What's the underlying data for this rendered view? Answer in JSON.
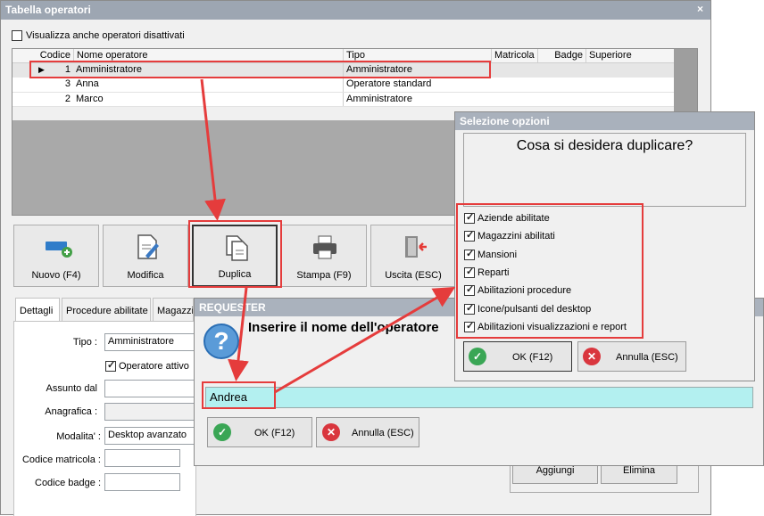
{
  "main_window": {
    "title": "Tabella operatori",
    "close_glyph": "×",
    "show_disabled_label": "Visualizza anche operatori disattivati",
    "grid": {
      "headers": [
        "Codice",
        "Nome operatore",
        "Tipo",
        "Matricola",
        "Badge",
        "Superiore"
      ],
      "rows": [
        {
          "codice": "1",
          "nome": "Amministratore",
          "tipo": "Amministratore"
        },
        {
          "codice": "3",
          "nome": "Anna",
          "tipo": "Operatore standard"
        },
        {
          "codice": "2",
          "nome": "Marco",
          "tipo": "Amministratore"
        }
      ],
      "row_pointer_glyph": "▶"
    },
    "toolbar": {
      "nuovo": "Nuovo (F4)",
      "modifica": "Modifica",
      "duplica": "Duplica",
      "stampa": "Stampa (F9)",
      "uscita": "Uscita (ESC)"
    },
    "tabs": [
      "Dettagli",
      "Procedure abilitate",
      "Magazzi"
    ],
    "form": {
      "tipo_label": "Tipo :",
      "tipo_value": "Amministratore",
      "operatore_attivo_label": "Operatore attivo",
      "assunto_label": "Assunto dal",
      "anagrafica_label": "Anagrafica :",
      "modalita_label": "Modalita' :",
      "modalita_value": "Desktop avanzato",
      "matricola_label": "Codice matricola :",
      "badge_label": "Codice badge :"
    },
    "hidden_buttons": {
      "aggiungi": "Aggiungi",
      "elimina": "Elimina"
    }
  },
  "options_dialog": {
    "title": "Selezione opzioni",
    "question": "Cosa si desidera duplicare?",
    "options": [
      "Aziende abilitate",
      "Magazzini abilitati",
      "Mansioni",
      "Reparti",
      "Abilitazioni procedure",
      "Icone/pulsanti del desktop",
      "Abilitazioni visualizzazioni e report"
    ],
    "ok_label": "OK (F12)",
    "cancel_label": "Annulla (ESC)"
  },
  "requester_dialog": {
    "title": "REQUESTER",
    "prompt": "Inserire il nome dell'operatore",
    "icon_glyph": "?",
    "input_value": "Andrea",
    "ok_label": "OK (F12)",
    "cancel_label": "Annulla (ESC)"
  },
  "colors": {
    "titlebar": "#9da6b2",
    "annotation": "#e53c3c",
    "input_highlight": "#b3f0f0",
    "ok_green": "#3aa655",
    "cancel_red": "#d9363e"
  }
}
